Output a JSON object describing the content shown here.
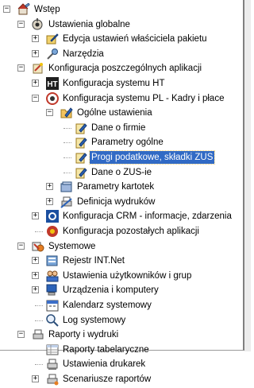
{
  "tree": {
    "rows": [
      {
        "level": 0,
        "expander": "minus",
        "icon": "home-app-icon",
        "label": "Wstęp"
      },
      {
        "level": 1,
        "expander": "minus",
        "icon": "globe-settings-icon",
        "label": "Ustawienia globalne"
      },
      {
        "level": 2,
        "expander": "plus",
        "icon": "edit-package-icon",
        "label": "Edycja ustawień właściciela pakietu"
      },
      {
        "level": 2,
        "expander": "plus",
        "icon": "tools-icon",
        "label": "Narzędzia"
      },
      {
        "level": 1,
        "expander": "minus",
        "icon": "configure-apps-icon",
        "label": "Konfiguracja poszczególnych aplikacji"
      },
      {
        "level": 2,
        "expander": "plus",
        "icon": "ht-app-icon",
        "label": "Konfiguracja systemu HT"
      },
      {
        "level": 2,
        "expander": "minus",
        "icon": "pl-app-icon",
        "label": "Konfiguracja systemu PL - Kadry i płace"
      },
      {
        "level": 3,
        "expander": "minus",
        "icon": "edit-folder-icon",
        "label": "Ogólne ustawienia"
      },
      {
        "level": 4,
        "expander": "none",
        "icon": "edit-doc-icon",
        "label": "Dane o firmie"
      },
      {
        "level": 4,
        "expander": "none",
        "icon": "edit-doc-icon",
        "label": "Parametry ogólne"
      },
      {
        "level": 4,
        "expander": "none",
        "icon": "edit-doc-icon",
        "label": "Progi podatkowe, składki ZUS",
        "selected": true
      },
      {
        "level": 4,
        "expander": "none",
        "icon": "edit-doc-icon",
        "label": "Dane o ZUS-ie"
      },
      {
        "level": 3,
        "expander": "plus",
        "icon": "cards-icon",
        "label": "Parametry kartotek"
      },
      {
        "level": 3,
        "expander": "plus",
        "icon": "printer-def-icon",
        "label": "Definicja wydruków"
      },
      {
        "level": 2,
        "expander": "plus",
        "icon": "crm-app-icon",
        "label": "Konfiguracja CRM - informacje, zdarzenia"
      },
      {
        "level": 2,
        "expander": "none",
        "icon": "other-apps-icon",
        "label": "Konfiguracja pozostałych aplikacji"
      },
      {
        "level": 1,
        "expander": "minus",
        "icon": "system-icon",
        "label": "Systemowe"
      },
      {
        "level": 2,
        "expander": "plus",
        "icon": "registry-icon",
        "label": "Rejestr INT.Net"
      },
      {
        "level": 2,
        "expander": "plus",
        "icon": "users-groups-icon",
        "label": "Ustawienia użytkowników i grup"
      },
      {
        "level": 2,
        "expander": "plus",
        "icon": "devices-computers-icon",
        "label": "Urządzenia i komputery"
      },
      {
        "level": 2,
        "expander": "none",
        "icon": "calendar-icon",
        "label": "Kalendarz systemowy"
      },
      {
        "level": 2,
        "expander": "none",
        "icon": "system-log-icon",
        "label": "Log systemowy"
      },
      {
        "level": 1,
        "expander": "minus",
        "icon": "reports-prints-icon",
        "label": "Raporty i wydruki"
      },
      {
        "level": 2,
        "expander": "none",
        "icon": "table-report-icon",
        "label": "Raporty tabelaryczne"
      },
      {
        "level": 2,
        "expander": "none",
        "icon": "printer-settings-icon",
        "label": "Ustawienia drukarek"
      },
      {
        "level": 2,
        "expander": "plus",
        "icon": "report-scenario-icon",
        "label": "Scenariusze raportów"
      }
    ]
  }
}
